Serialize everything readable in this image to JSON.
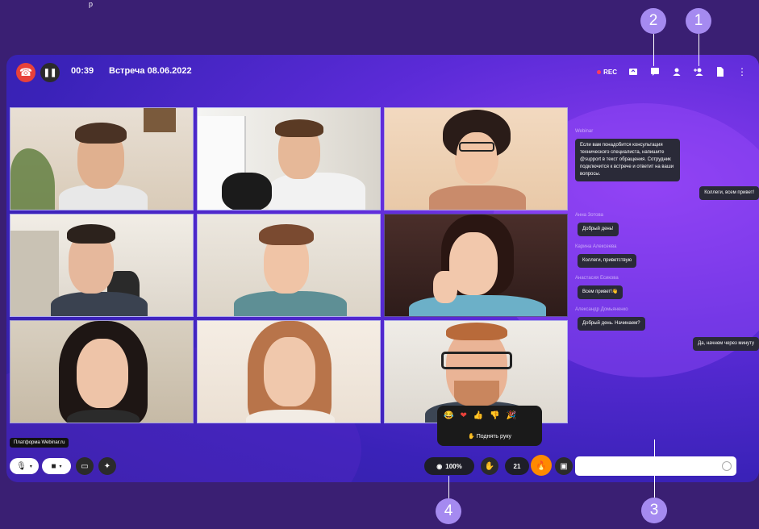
{
  "header": {
    "timer": "00:39",
    "meeting_title": "Встреча 08.06.2022",
    "rec_label": "REC",
    "top_fragment": "р"
  },
  "chat": {
    "messages": [
      {
        "sender": "Webinar",
        "text": "Если вам понадобится консультация технического специалиста, напишите @support в текст обращения. Сотрудник подключится к встрече и ответит на ваши вопросы.",
        "align": "left"
      },
      {
        "sender": "",
        "text": "Коллеги, всем привет!",
        "align": "right"
      },
      {
        "sender": "Анна Зотова",
        "text": "Добрый день!",
        "align": "left"
      },
      {
        "sender": "Карина Алексеева",
        "text": "Коллеги, приветствую",
        "align": "left"
      },
      {
        "sender": "Анастасия Есикова",
        "text": "Всем привет!👋",
        "align": "left"
      },
      {
        "sender": "Александр Домьяненко",
        "text": "Добрый день. Начинаем?",
        "align": "left"
      },
      {
        "sender": "",
        "text": "Да, начнем через минуту",
        "align": "right"
      }
    ]
  },
  "controls": {
    "tooltip": "Платформа Webinar.ru",
    "view_percent": "100%",
    "participants_count": "21",
    "raise_hand": "Поднять руку",
    "reactions": [
      "😂",
      "❤",
      "👍",
      "👎",
      "🎉"
    ]
  },
  "callouts": [
    "1",
    "2",
    "3",
    "4"
  ],
  "colors": {
    "hangup": "#e8413a",
    "accent_orange": "#ff8a00",
    "callout": "#a58af0",
    "background": "#3a1f73"
  },
  "icons": [
    "phone-hangup-icon",
    "pause-icon",
    "screen-share-icon",
    "chat-icon",
    "person-icon",
    "add-person-icon",
    "file-icon",
    "more-icon",
    "mic-icon",
    "camera-icon",
    "whiteboard-icon",
    "magic-icon",
    "eye-icon",
    "hand-icon",
    "reaction-icon",
    "picture-in-picture-icon"
  ]
}
